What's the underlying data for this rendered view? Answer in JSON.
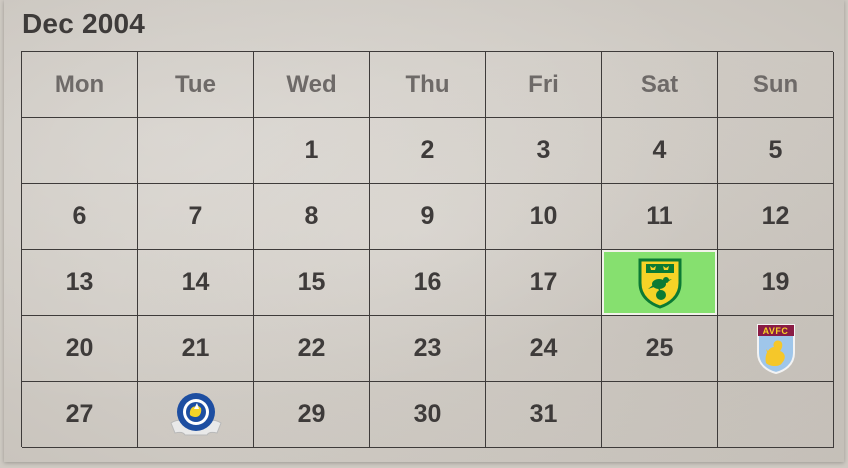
{
  "calendar": {
    "title": "Dec 2004",
    "weekdays": [
      "Mon",
      "Tue",
      "Wed",
      "Thu",
      "Fri",
      "Sat",
      "Sun"
    ],
    "weeks": [
      [
        "",
        "",
        "1",
        "2",
        "3",
        "4",
        "5"
      ],
      [
        "6",
        "7",
        "8",
        "9",
        "10",
        "11",
        "12"
      ],
      [
        "13",
        "14",
        "15",
        "16",
        "17",
        "",
        "19"
      ],
      [
        "20",
        "21",
        "22",
        "23",
        "24",
        "25",
        ""
      ],
      [
        "27",
        "",
        "29",
        "30",
        "31",
        "",
        ""
      ]
    ],
    "events": {
      "18": {
        "crest": "norwich-city-crest-icon",
        "highlight": "#86e06f"
      },
      "26": {
        "crest": "aston-villa-crest-icon",
        "text": "AVFC"
      },
      "28": {
        "crest": "portsmouth-crest-icon"
      }
    }
  },
  "colors": {
    "text": "#3e3b3a",
    "header_text": "#6e6a68",
    "highlight": "#86e06f",
    "villa_claret": "#8a1c45",
    "villa_blue": "#9fc6ea",
    "pompey_blue": "#1d4ea1",
    "norwich_yellow": "#f5d327",
    "norwich_green": "#0b7a34"
  }
}
